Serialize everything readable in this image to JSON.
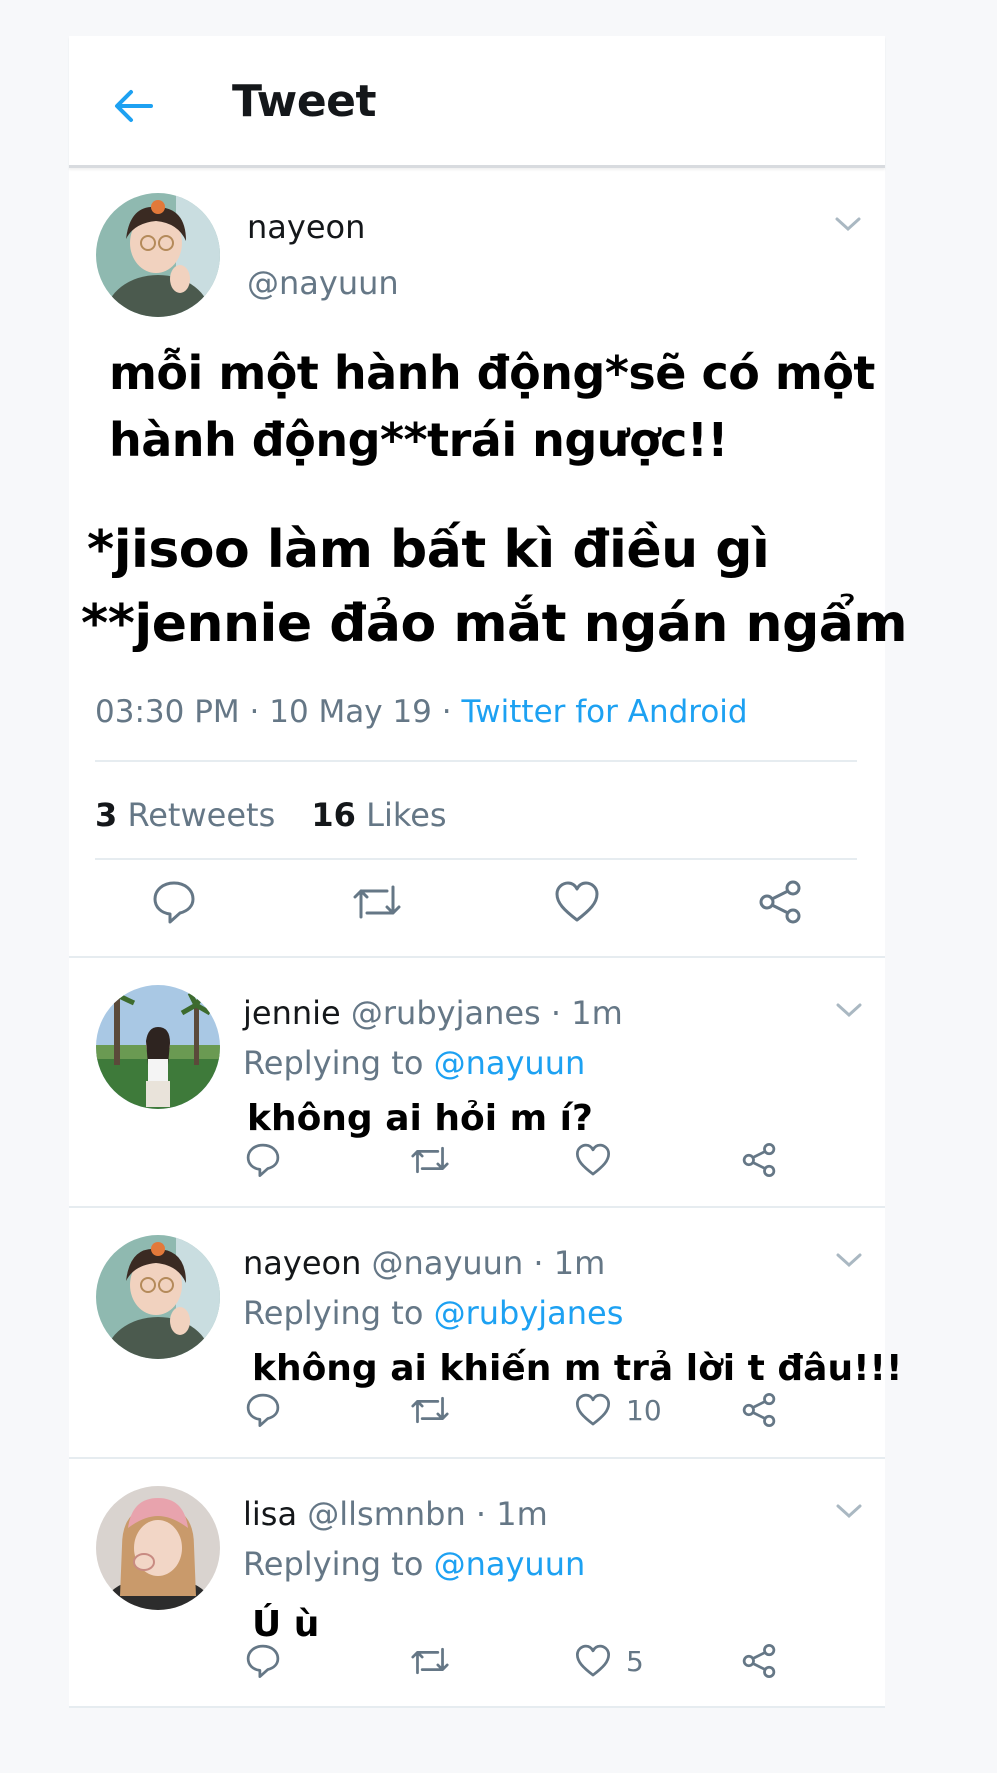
{
  "header": {
    "title": "Tweet"
  },
  "tweet": {
    "name": "nayeon",
    "handle": "@nayuun",
    "lines": [
      "mỗi một hành động*sẽ có một",
      "hành động**trái ngược!!",
      "*jisoo làm bất kì điều gì",
      "**jennie đảo mắt ngán ngẩm"
    ],
    "time": "03:30 PM",
    "date": "10 May 19",
    "separator": "·",
    "client": "Twitter for Android",
    "retweets_count": "3",
    "retweets_label": "Retweets",
    "likes_count": "16",
    "likes_label": "Likes"
  },
  "replies": [
    {
      "name": "jennie",
      "handle": "@rubyjanes",
      "time": "1m",
      "replying_label": "Replying to",
      "replying_to": "@nayuun",
      "text": "không ai hỏi m í?",
      "like_count": ""
    },
    {
      "name": "nayeon",
      "handle": "@nayuun",
      "time": "1m",
      "replying_label": "Replying to",
      "replying_to": "@rubyjanes",
      "text": "không ai khiến m trả lời t đâu!!!",
      "like_count": "10"
    },
    {
      "name": "lisa",
      "handle": "@llsmnbn",
      "time": "1m",
      "replying_label": "Replying to",
      "replying_to": "@nayuun",
      "text": "Ú ù",
      "like_count": "5"
    }
  ],
  "colors": {
    "accent": "#1da1f2",
    "secondary_text": "#657786",
    "divider": "#e6ecf0"
  },
  "icons": [
    "back-arrow-icon",
    "chevron-down-icon",
    "reply-icon",
    "retweet-icon",
    "like-icon",
    "share-icon"
  ]
}
